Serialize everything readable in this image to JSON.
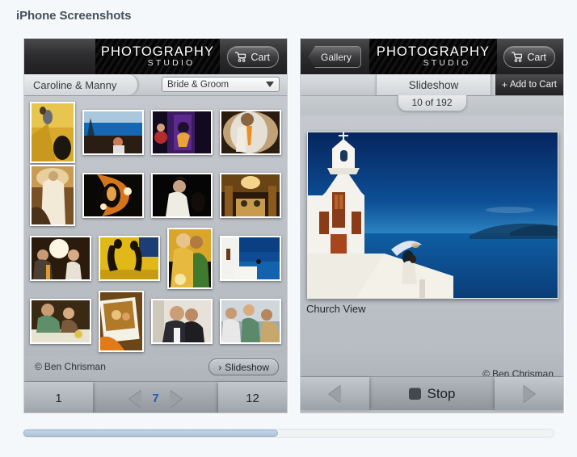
{
  "page": {
    "title": "iPhone Screenshots",
    "background_color": "#f4f8fb",
    "title_color": "#46505a"
  },
  "left_phone": {
    "logo": {
      "line1": "PHOTOGRAPHY",
      "line2": "STUDIO"
    },
    "cart_button": {
      "label": "Cart",
      "icon": "cart-icon"
    },
    "album_tab": {
      "label": "Caroline & Manny"
    },
    "category_select": {
      "value": "Bride & Groom",
      "icon": "chevron-down-icon"
    },
    "copyright": {
      "symbol": "©",
      "label": "Ben Chrisman"
    },
    "slideshow_button": {
      "icon": "›",
      "label": "Slideshow"
    },
    "pager": {
      "first_page": "1",
      "last_page": "12",
      "current_page": "7",
      "prev_icon": "triangle-left-icon",
      "next_icon": "triangle-right-icon",
      "current_color": "#1d5fae"
    },
    "thumbnails": [
      {
        "id": "t1",
        "orientation": "portrait",
        "scene": "yellow-stairs-couple"
      },
      {
        "id": "t2",
        "orientation": "landscape",
        "scene": "boat-harbor-blue"
      },
      {
        "id": "t3",
        "orientation": "landscape",
        "scene": "purple-stage-dancer"
      },
      {
        "id": "t4",
        "orientation": "landscape",
        "scene": "groom-orange-tie"
      },
      {
        "id": "t5",
        "orientation": "portrait",
        "scene": "bride-white-dress-warm"
      },
      {
        "id": "t6",
        "orientation": "landscape",
        "scene": "orange-dark-reflection"
      },
      {
        "id": "t7",
        "orientation": "landscape",
        "scene": "dark-portrait-white-dress"
      },
      {
        "id": "t8",
        "orientation": "landscape",
        "scene": "warm-reception-hall"
      },
      {
        "id": "t9",
        "orientation": "landscape",
        "scene": "reception-group-flash"
      },
      {
        "id": "t10",
        "orientation": "landscape",
        "scene": "yellow-silhouette-kiss"
      },
      {
        "id": "t11",
        "orientation": "portrait",
        "scene": "golden-embrace"
      },
      {
        "id": "t12",
        "orientation": "landscape",
        "scene": "white-church-blue-sea"
      },
      {
        "id": "t13",
        "orientation": "landscape",
        "scene": "dinner-table-toast"
      },
      {
        "id": "t14",
        "orientation": "portrait",
        "scene": "polaroid-in-hand"
      },
      {
        "id": "t15",
        "orientation": "landscape",
        "scene": "two-men-kissing-cheek"
      },
      {
        "id": "t16",
        "orientation": "landscape",
        "scene": "crowd-bouquet-toss"
      }
    ]
  },
  "right_phone": {
    "back_button": {
      "label": "Gallery",
      "icon": "chevron-left-icon"
    },
    "logo": {
      "line1": "PHOTOGRAPHY",
      "line2": "STUDIO"
    },
    "cart_button": {
      "label": "Cart",
      "icon": "cart-icon"
    },
    "slideshow_tab": {
      "label": "Slideshow"
    },
    "add_to_cart_button": {
      "icon": "+",
      "label": "Add to Cart"
    },
    "counter": {
      "label": "10 of 192",
      "current": 10,
      "total": 192
    },
    "photo": {
      "caption": "Church View",
      "scene": "white-church-blue-sea-santorini"
    },
    "copyright": {
      "symbol": "©",
      "label": "Ben Chrisman"
    },
    "controls": {
      "prev_icon": "triangle-left-icon",
      "next_icon": "triangle-right-icon",
      "stop_label": "Stop",
      "stop_icon": "stop-square-icon"
    }
  },
  "scrollbar": {
    "orientation": "horizontal",
    "thumb_percent": 48
  }
}
